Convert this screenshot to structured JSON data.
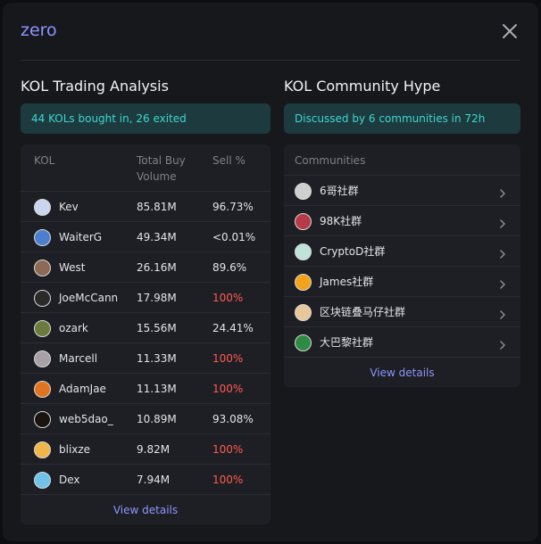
{
  "modal": {
    "title": "zero"
  },
  "kol": {
    "title": "KOL Trading Analysis",
    "banner": "44 KOLs bought in, 26 exited",
    "headers": {
      "kol": "KOL",
      "volume_line1": "Total Buy",
      "volume_line2": "Volume",
      "sell": "Sell %"
    },
    "rows": [
      {
        "name": "Kev",
        "volume": "85.81M",
        "sell": "96.73%",
        "red": false,
        "avatar_color": "#c9d6f0"
      },
      {
        "name": "WaiterG",
        "volume": "49.34M",
        "sell": "<0.01%",
        "red": false,
        "avatar_color": "#4c7fd0"
      },
      {
        "name": "West",
        "volume": "26.16M",
        "sell": "89.6%",
        "red": false,
        "avatar_color": "#8c6a55"
      },
      {
        "name": "JoeMcCann",
        "volume": "17.98M",
        "sell": "100%",
        "red": true,
        "avatar_color": "#2a2a2a"
      },
      {
        "name": "ozark",
        "volume": "15.56M",
        "sell": "24.41%",
        "red": false,
        "avatar_color": "#6c7a3e"
      },
      {
        "name": "Marcell",
        "volume": "11.33M",
        "sell": "100%",
        "red": true,
        "avatar_color": "#a7a0a4"
      },
      {
        "name": "AdamJae",
        "volume": "11.13M",
        "sell": "100%",
        "red": true,
        "avatar_color": "#e0741f"
      },
      {
        "name": "web5dao_",
        "volume": "10.89M",
        "sell": "93.08%",
        "red": false,
        "avatar_color": "#1a1410"
      },
      {
        "name": "blixze",
        "volume": "9.82M",
        "sell": "100%",
        "red": true,
        "avatar_color": "#f1b54a"
      },
      {
        "name": "Dex",
        "volume": "7.94M",
        "sell": "100%",
        "red": true,
        "avatar_color": "#6fc3e8"
      }
    ],
    "view_details": "View details"
  },
  "community": {
    "title": "KOL Community Hype",
    "banner": "Discussed by 6 communities in 72h",
    "header": "Communities",
    "rows": [
      {
        "name": "6哥社群",
        "avatar_color": "#cfcfcf"
      },
      {
        "name": "98K社群",
        "avatar_color": "#b73a49"
      },
      {
        "name": "CryptoD社群",
        "avatar_color": "#bfe3d8"
      },
      {
        "name": "James社群",
        "avatar_color": "#f2a31b"
      },
      {
        "name": "区块链叠马仔社群",
        "avatar_color": "#e8c79a"
      },
      {
        "name": "大巴黎社群",
        "avatar_color": "#2d8b46"
      }
    ],
    "view_details": "View details"
  },
  "colors": {
    "accent": "#8d95ff",
    "teal": "#3ed6d0",
    "red": "#ff5a4f"
  }
}
